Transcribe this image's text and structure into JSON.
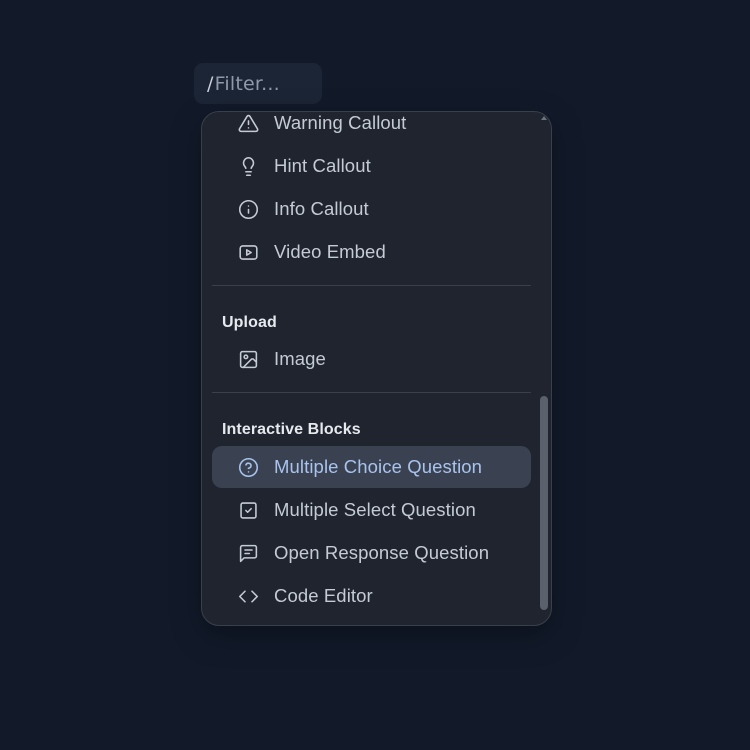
{
  "filter": {
    "slash": "/",
    "placeholder": "Filter..."
  },
  "menu": {
    "items_top": [
      {
        "label": "Warning Callout",
        "icon": "warning-icon"
      },
      {
        "label": "Hint Callout",
        "icon": "lightbulb-icon"
      },
      {
        "label": "Info Callout",
        "icon": "info-icon"
      },
      {
        "label": "Video Embed",
        "icon": "video-icon"
      }
    ],
    "sections": [
      {
        "title": "Upload",
        "items": [
          {
            "label": "Image",
            "icon": "image-icon"
          }
        ]
      },
      {
        "title": "Interactive Blocks",
        "items": [
          {
            "label": "Multiple Choice Question",
            "icon": "question-circle-icon",
            "active": true
          },
          {
            "label": "Multiple Select Question",
            "icon": "checkbox-icon"
          },
          {
            "label": "Open Response Question",
            "icon": "message-text-icon"
          },
          {
            "label": "Code Editor",
            "icon": "code-icon"
          }
        ]
      }
    ]
  },
  "colors": {
    "background": "#121a2a",
    "menu_bg": "#1f242e",
    "active_bg": "#3a4252",
    "active_text": "#a9c3ec",
    "text": "#c5cbd4"
  }
}
